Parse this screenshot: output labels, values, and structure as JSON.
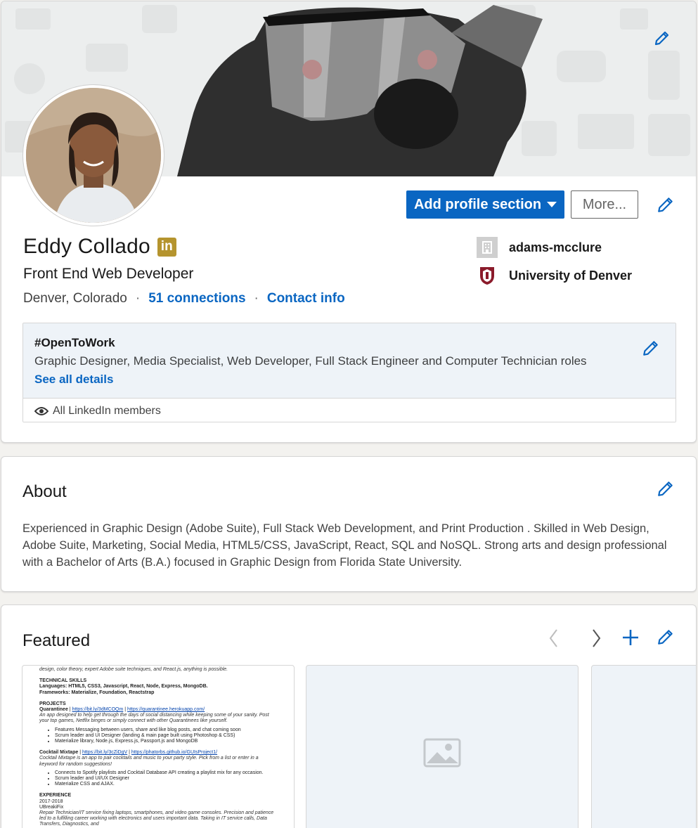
{
  "profile": {
    "name": "Eddy Collado",
    "badge_text": "in",
    "headline": "Front End Web Developer",
    "location": "Denver, Colorado",
    "separator": "·",
    "connections": "51 connections",
    "contact_info": "Contact info",
    "company": "adams-mcclure",
    "school": "University of Denver"
  },
  "actions": {
    "add_section": "Add profile section",
    "more": "More..."
  },
  "open_to_work": {
    "title": "#OpenToWork",
    "roles": "Graphic Designer, Media Specialist, Web Developer, Full Stack Engineer and Computer Technician roles",
    "see_all": "See all details",
    "visibility": "All LinkedIn members"
  },
  "about": {
    "title": "About",
    "text": "Experienced in Graphic Design (Adobe Suite), Full Stack Web Development, and Print Production . Skilled in Web Design, Adobe Suite, Marketing, Social Media, HTML5/CSS, JavaScript, React, SQL and NoSQL. Strong arts and design professional with a Bachelor of Arts (B.A.) focused in Graphic Design from Florida State University."
  },
  "featured": {
    "title": "Featured",
    "resume": {
      "intro": "design, color theory, expert Adobe suite techniques, and React.js, anything is possible.",
      "skills_heading": "TECHNICAL SKILLS",
      "languages": "Languages: HTML5, CSS3, Javascript, React, Node, Express, MongoDB.",
      "frameworks": "Frameworks: Materialize, Foundation, Reactstrap",
      "projects_heading": "PROJECTS",
      "p1_name": "Quarantinee",
      "p1_sep": " | ",
      "p1_link1": "https://bit.ly/3dMCOQm",
      "p1_link2": "https://quarantinee.herokuapp.com/",
      "p1_desc": "An app designed to help get through the days of social distancing while keeping some of your sanity. Post your top games, Netflix binges or simply connect with other Quarantinees like yourself.",
      "p1_bullets": [
        "Features Messaging between users, share and like blog posts, and chat coming soon",
        "Scrum leader and UI Designer (landing & main page built using Photoshop & CSS)",
        "Materialize library, Node.js, Express.js, Passport.js and MongoDB"
      ],
      "p2_name": "Cocktail Mixtape",
      "p2_link1": "https://bit.ly/3cZiDgV",
      "p2_link2": "https://phatorbs.github.io/GUIsProject1/",
      "p2_desc": "Cocktail Mixtape is an app to pair cocktails and music to your party style. Pick from a list or enter in a keyword for random suggestions!",
      "p2_bullets": [
        "Connects to Spotify playlists and Cocktail Database API creating a playlist mix for any occasion.",
        "Scrum leader and UI/UX Designer",
        "Materialize CSS and AJAX."
      ],
      "exp_heading": "EXPERIENCE",
      "exp_years": "2017-2018",
      "exp_company": "UBreakiFix",
      "exp_desc": "Repair Technician/IT service fixing laptops, smartphones, and video game consoles. Precision and patience led to a fulfilling career working with electronics and users important data. Taking in IT service calls, Data Transfers, Diagnostics, and"
    }
  },
  "colors": {
    "primary": "#0a66c2",
    "badge": "#b5942e",
    "otw_bg": "#eef3f8"
  },
  "icons": [
    "pencil-icon",
    "caret-down-icon",
    "building-icon",
    "university-shield-icon",
    "eye-icon",
    "chevron-left-icon",
    "chevron-right-icon",
    "plus-icon",
    "image-placeholder-icon"
  ]
}
